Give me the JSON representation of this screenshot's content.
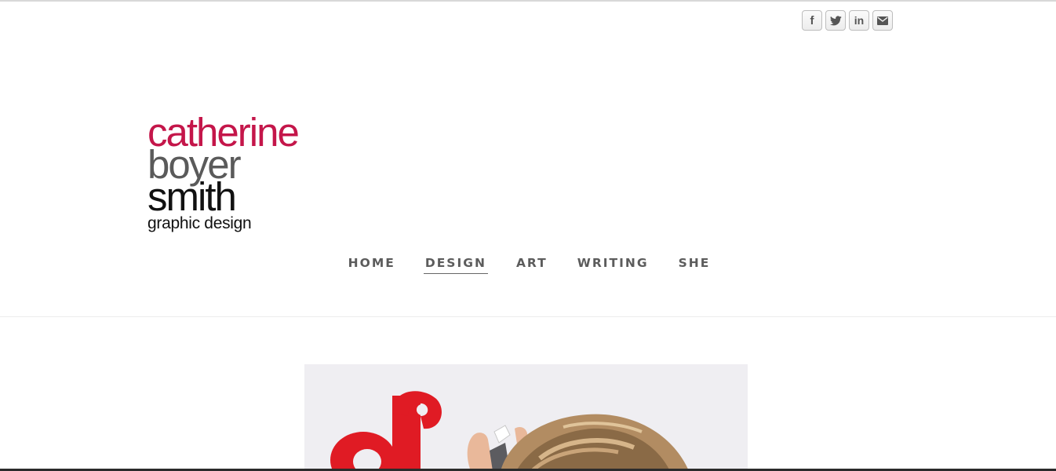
{
  "social": [
    {
      "icon": "facebook-icon",
      "glyph": "f"
    },
    {
      "icon": "twitter-icon",
      "glyph": ""
    },
    {
      "icon": "linkedin-icon",
      "glyph": "in"
    },
    {
      "icon": "email-icon",
      "glyph": ""
    }
  ],
  "logo": {
    "line1": "catherine",
    "line2": "boyer",
    "line3": "smith",
    "line4": "graphic design"
  },
  "nav": [
    {
      "label": "HOME"
    },
    {
      "label": "DESIGN",
      "active": true
    },
    {
      "label": "ART"
    },
    {
      "label": "WRITING"
    },
    {
      "label": "SHE"
    }
  ],
  "colors": {
    "logo_accent": "#c4164a",
    "logo_gray": "#5a5a5a",
    "nav_text": "#5c5c5c",
    "hero_bg": "#efeef2",
    "hero_red": "#e01b24"
  }
}
